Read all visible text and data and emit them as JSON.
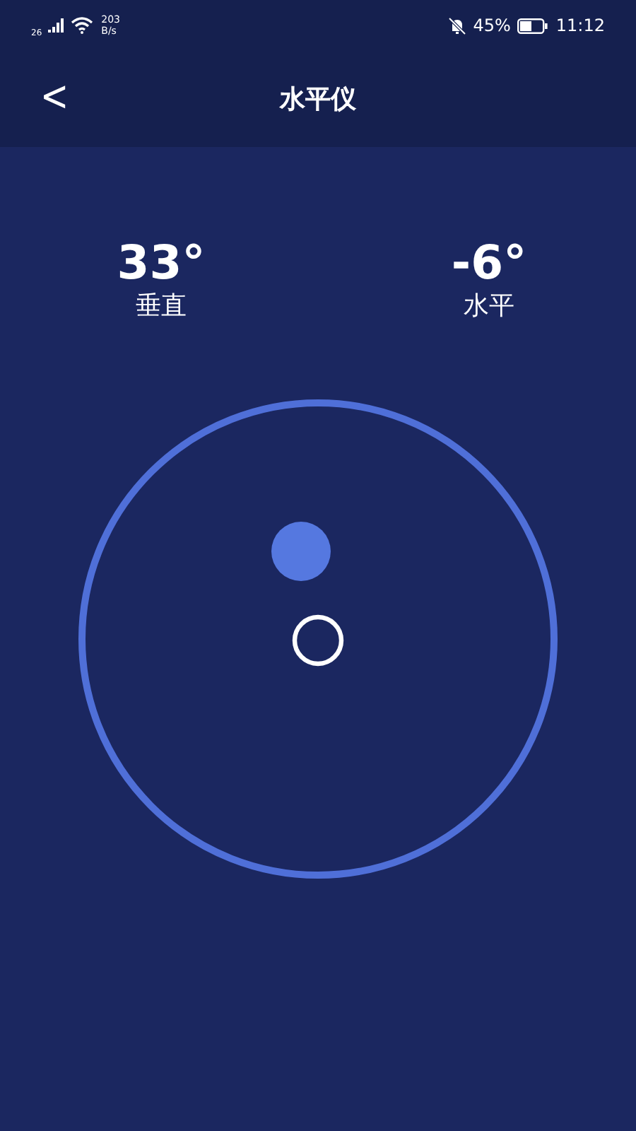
{
  "status_bar": {
    "network": "26",
    "speed_value": "203",
    "speed_unit": "B/s",
    "battery": "45%",
    "time": "11:12"
  },
  "header": {
    "back": "<",
    "title": "水平仪"
  },
  "readings": [
    {
      "value": "33°",
      "label": "垂直"
    },
    {
      "value": "-6°",
      "label": "水平"
    }
  ]
}
